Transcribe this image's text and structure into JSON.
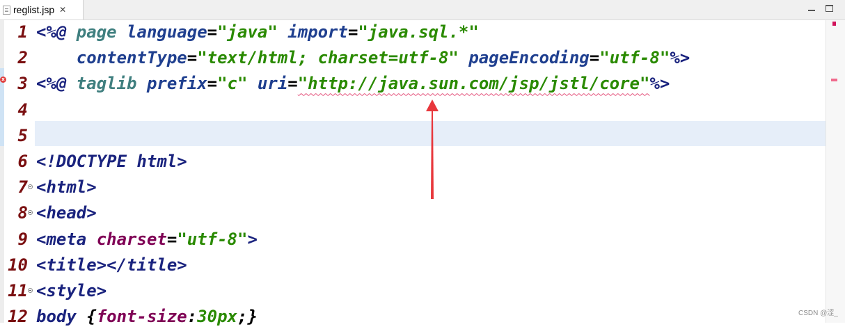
{
  "tab": {
    "title": "reglist.jsp",
    "close_glyph": "✕"
  },
  "window_controls": [
    "minimize-icon",
    "maximize-icon"
  ],
  "editor": {
    "lines": [
      {
        "number": "1",
        "tokens": [
          [
            "tag",
            "<%@ "
          ],
          [
            "dir",
            "page "
          ],
          [
            "attr",
            "language"
          ],
          [
            "plain",
            "="
          ],
          [
            "str",
            "\"java\""
          ],
          [
            "plain",
            " "
          ],
          [
            "attr",
            "import"
          ],
          [
            "plain",
            "="
          ],
          [
            "str",
            "\"java.sql.*\""
          ]
        ]
      },
      {
        "number": "2",
        "tokens": [
          [
            "plain",
            "    "
          ],
          [
            "attr",
            "contentType"
          ],
          [
            "plain",
            "="
          ],
          [
            "str",
            "\"text/html; charset=utf-8\""
          ],
          [
            "plain",
            " "
          ],
          [
            "attr",
            "pageEncoding"
          ],
          [
            "plain",
            "="
          ],
          [
            "str",
            "\"utf-8\""
          ],
          [
            "tag",
            "%>"
          ]
        ]
      },
      {
        "number": "3",
        "tokens": [
          [
            "tag",
            "<%@ "
          ],
          [
            "dir",
            "taglib "
          ],
          [
            "attr",
            "prefix"
          ],
          [
            "plain",
            "="
          ],
          [
            "str",
            "\"c\""
          ],
          [
            "plain",
            " "
          ],
          [
            "attr",
            "uri"
          ],
          [
            "plain",
            "="
          ],
          [
            "str-err",
            "\"http://java.sun.com/jsp/jstl/core\""
          ],
          [
            "tag",
            "%>"
          ]
        ]
      },
      {
        "number": "4",
        "tokens": []
      },
      {
        "number": "5",
        "tokens": []
      },
      {
        "number": "6",
        "tokens": [
          [
            "tag",
            "<!DOCTYPE html>"
          ]
        ]
      },
      {
        "number": "7",
        "fold": true,
        "tokens": [
          [
            "tag",
            "<html>"
          ]
        ]
      },
      {
        "number": "8",
        "fold": true,
        "tokens": [
          [
            "tag",
            "<head>"
          ]
        ]
      },
      {
        "number": "9",
        "tokens": [
          [
            "tag",
            "<meta "
          ],
          [
            "prop",
            "charset"
          ],
          [
            "plain",
            "="
          ],
          [
            "str",
            "\"utf-8\""
          ],
          [
            "tag",
            ">"
          ]
        ]
      },
      {
        "number": "10",
        "tokens": [
          [
            "tag",
            "<title></title>"
          ]
        ]
      },
      {
        "number": "11",
        "fold": true,
        "tokens": [
          [
            "tag",
            "<style>"
          ]
        ]
      },
      {
        "number": "12",
        "tokens": [
          [
            "tag",
            "body "
          ],
          [
            "plain",
            "{"
          ],
          [
            "prop",
            "font-size"
          ],
          [
            "plain",
            ":"
          ],
          [
            "num",
            "30px"
          ],
          [
            "plain",
            ";}"
          ]
        ]
      }
    ],
    "current_line": "5"
  },
  "gutter": {
    "error_icon": "error-icon"
  },
  "overview_ruler": {
    "error_color": "#d1125a",
    "annotation_color": "#f06a8d"
  },
  "annotation": {
    "arrow_color": "#e8373c"
  },
  "watermark": "CSDN @涩_"
}
